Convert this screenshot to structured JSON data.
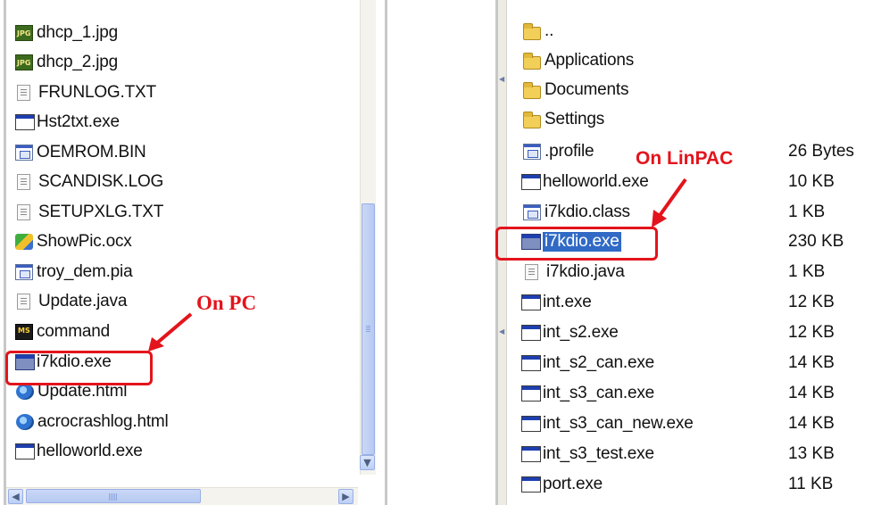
{
  "pc_pane": {
    "files": [
      {
        "name": "dhcp_1.jpg",
        "icon": "jpg-file-icon"
      },
      {
        "name": "dhcp_2.jpg",
        "icon": "jpg-file-icon"
      },
      {
        "name": "FRUNLOG.TXT",
        "icon": "text-file-icon"
      },
      {
        "name": "Hst2txt.exe",
        "icon": "exe-file-icon"
      },
      {
        "name": "OEMROM.BIN",
        "icon": "system-file-icon"
      },
      {
        "name": "SCANDISK.LOG",
        "icon": "text-file-icon"
      },
      {
        "name": "SETUPXLG.TXT",
        "icon": "text-file-icon"
      },
      {
        "name": "ShowPic.ocx",
        "icon": "ocx-file-icon"
      },
      {
        "name": "troy_dem.pia",
        "icon": "system-file-icon"
      },
      {
        "name": "Update.java",
        "icon": "java-file-icon"
      },
      {
        "name": "command",
        "icon": "msdos-command-icon"
      },
      {
        "name": "i7kdio.exe",
        "icon": "exe-file-icon"
      },
      {
        "name": "Update.html",
        "icon": "html-file-icon"
      },
      {
        "name": "acrocrashlog.html",
        "icon": "html-file-icon"
      },
      {
        "name": "helloworld.exe",
        "icon": "exe-file-icon"
      }
    ],
    "annotation": "On PC"
  },
  "linpac_pane": {
    "files": [
      {
        "name": "..",
        "size": "",
        "icon": "folder-icon"
      },
      {
        "name": "Applications",
        "size": "",
        "icon": "folder-icon"
      },
      {
        "name": "Documents",
        "size": "",
        "icon": "folder-icon"
      },
      {
        "name": "Settings",
        "size": "",
        "icon": "folder-icon"
      },
      {
        "name": ".profile",
        "size": "26 Bytes",
        "icon": "system-file-icon"
      },
      {
        "name": "helloworld.exe",
        "size": "10 KB",
        "icon": "exe-file-icon"
      },
      {
        "name": "i7kdio.class",
        "size": "1 KB",
        "icon": "system-file-icon"
      },
      {
        "name": "i7kdio.exe",
        "size": "230 KB",
        "icon": "exe-file-icon",
        "selected": true
      },
      {
        "name": "i7kdio.java",
        "size": "1 KB",
        "icon": "java-file-icon"
      },
      {
        "name": "int.exe",
        "size": "12 KB",
        "icon": "exe-file-icon"
      },
      {
        "name": "int_s2.exe",
        "size": "12 KB",
        "icon": "exe-file-icon"
      },
      {
        "name": "int_s2_can.exe",
        "size": "14 KB",
        "icon": "exe-file-icon"
      },
      {
        "name": "int_s3_can.exe",
        "size": "14 KB",
        "icon": "exe-file-icon"
      },
      {
        "name": "int_s3_can_new.exe",
        "size": "14 KB",
        "icon": "exe-file-icon"
      },
      {
        "name": "int_s3_test.exe",
        "size": "13 KB",
        "icon": "exe-file-icon"
      },
      {
        "name": "port.exe",
        "size": "11 KB",
        "icon": "exe-file-icon"
      }
    ],
    "annotation": "On LinPAC"
  },
  "colors": {
    "annotation_red": "#e3141c",
    "selection_blue": "#316ac5"
  }
}
